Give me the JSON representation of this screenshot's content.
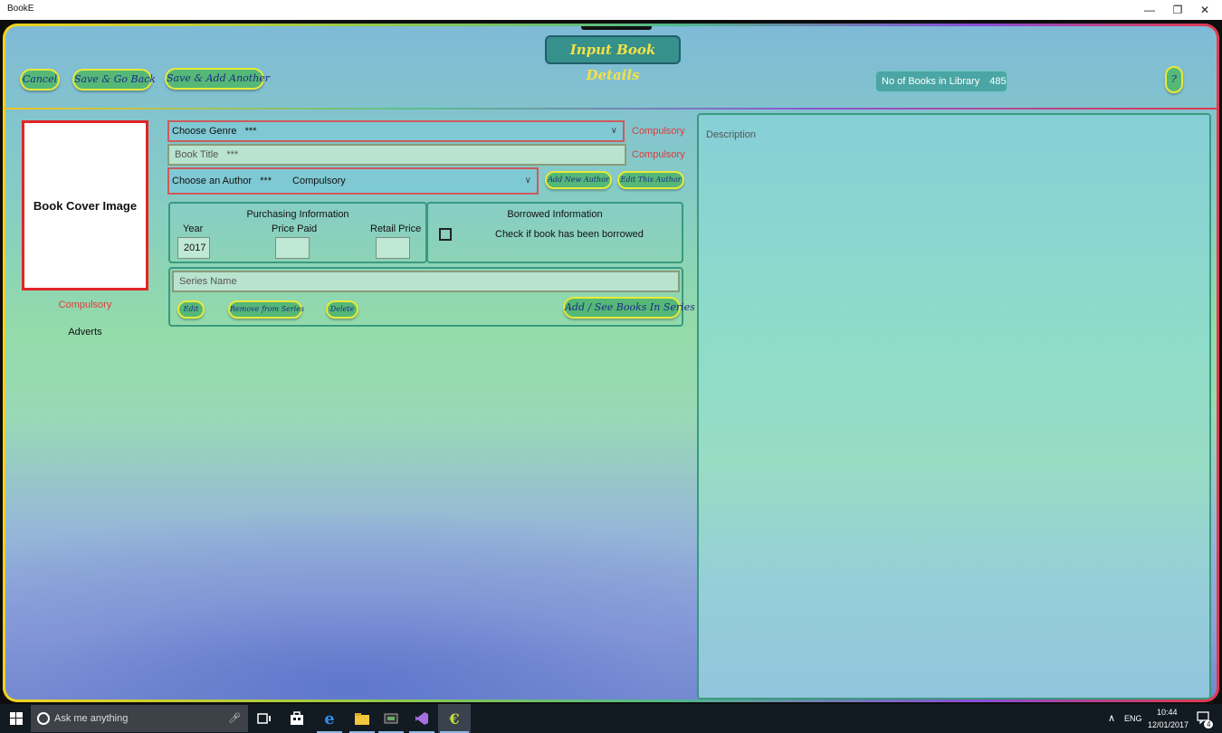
{
  "window": {
    "title": "BookE",
    "minimize": "—",
    "restore": "❐",
    "close": "✕"
  },
  "header": {
    "page_title": "Input Book Details",
    "cancel_label": "Cancel",
    "save_back_label": "Save & Go Back",
    "save_add_label": "Save & Add Another",
    "books_count_label": "No of Books in Library",
    "books_count_value": "485",
    "help_label": "?"
  },
  "cover": {
    "placeholder": "Book Cover Image",
    "compulsory": "Compulsory",
    "adverts": "Adverts"
  },
  "form": {
    "genre": {
      "label": "Choose Genre",
      "stars": "***",
      "compulsory": "Compulsory"
    },
    "title": {
      "placeholder": "Book Title",
      "stars": "***",
      "compulsory": "Compulsory"
    },
    "author": {
      "label": "Choose an Author",
      "stars": "***",
      "compulsory": "Compulsory"
    },
    "add_author_label": "Add New Author",
    "edit_author_label": "Edit This Author"
  },
  "purchasing": {
    "title": "Purchasing Information",
    "year_label": "Year",
    "year_value": "2017",
    "price_paid_label": "Price Paid",
    "price_paid_value": "",
    "retail_price_label": "Retail Price",
    "retail_price_value": ""
  },
  "borrowed": {
    "title": "Borrowed Information",
    "checkbox_label": "Check if book has been borrowed",
    "checked": false
  },
  "series": {
    "placeholder": "Series Name",
    "edit_label": "Edit",
    "remove_label": "Remove from Series",
    "delete_label": "Delete",
    "add_see_label": "Add / See Books In Series"
  },
  "description": {
    "placeholder": "Description"
  },
  "taskbar": {
    "search_placeholder": "Ask me anything",
    "language": "ENG",
    "time": "10:44",
    "date": "12/01/2017",
    "notification_count": "4"
  },
  "colors": {
    "compulsory_red": "#e23a3a",
    "button_green": "#55b877",
    "button_border": "#e8ea3a",
    "title_text": "#f3e247"
  }
}
